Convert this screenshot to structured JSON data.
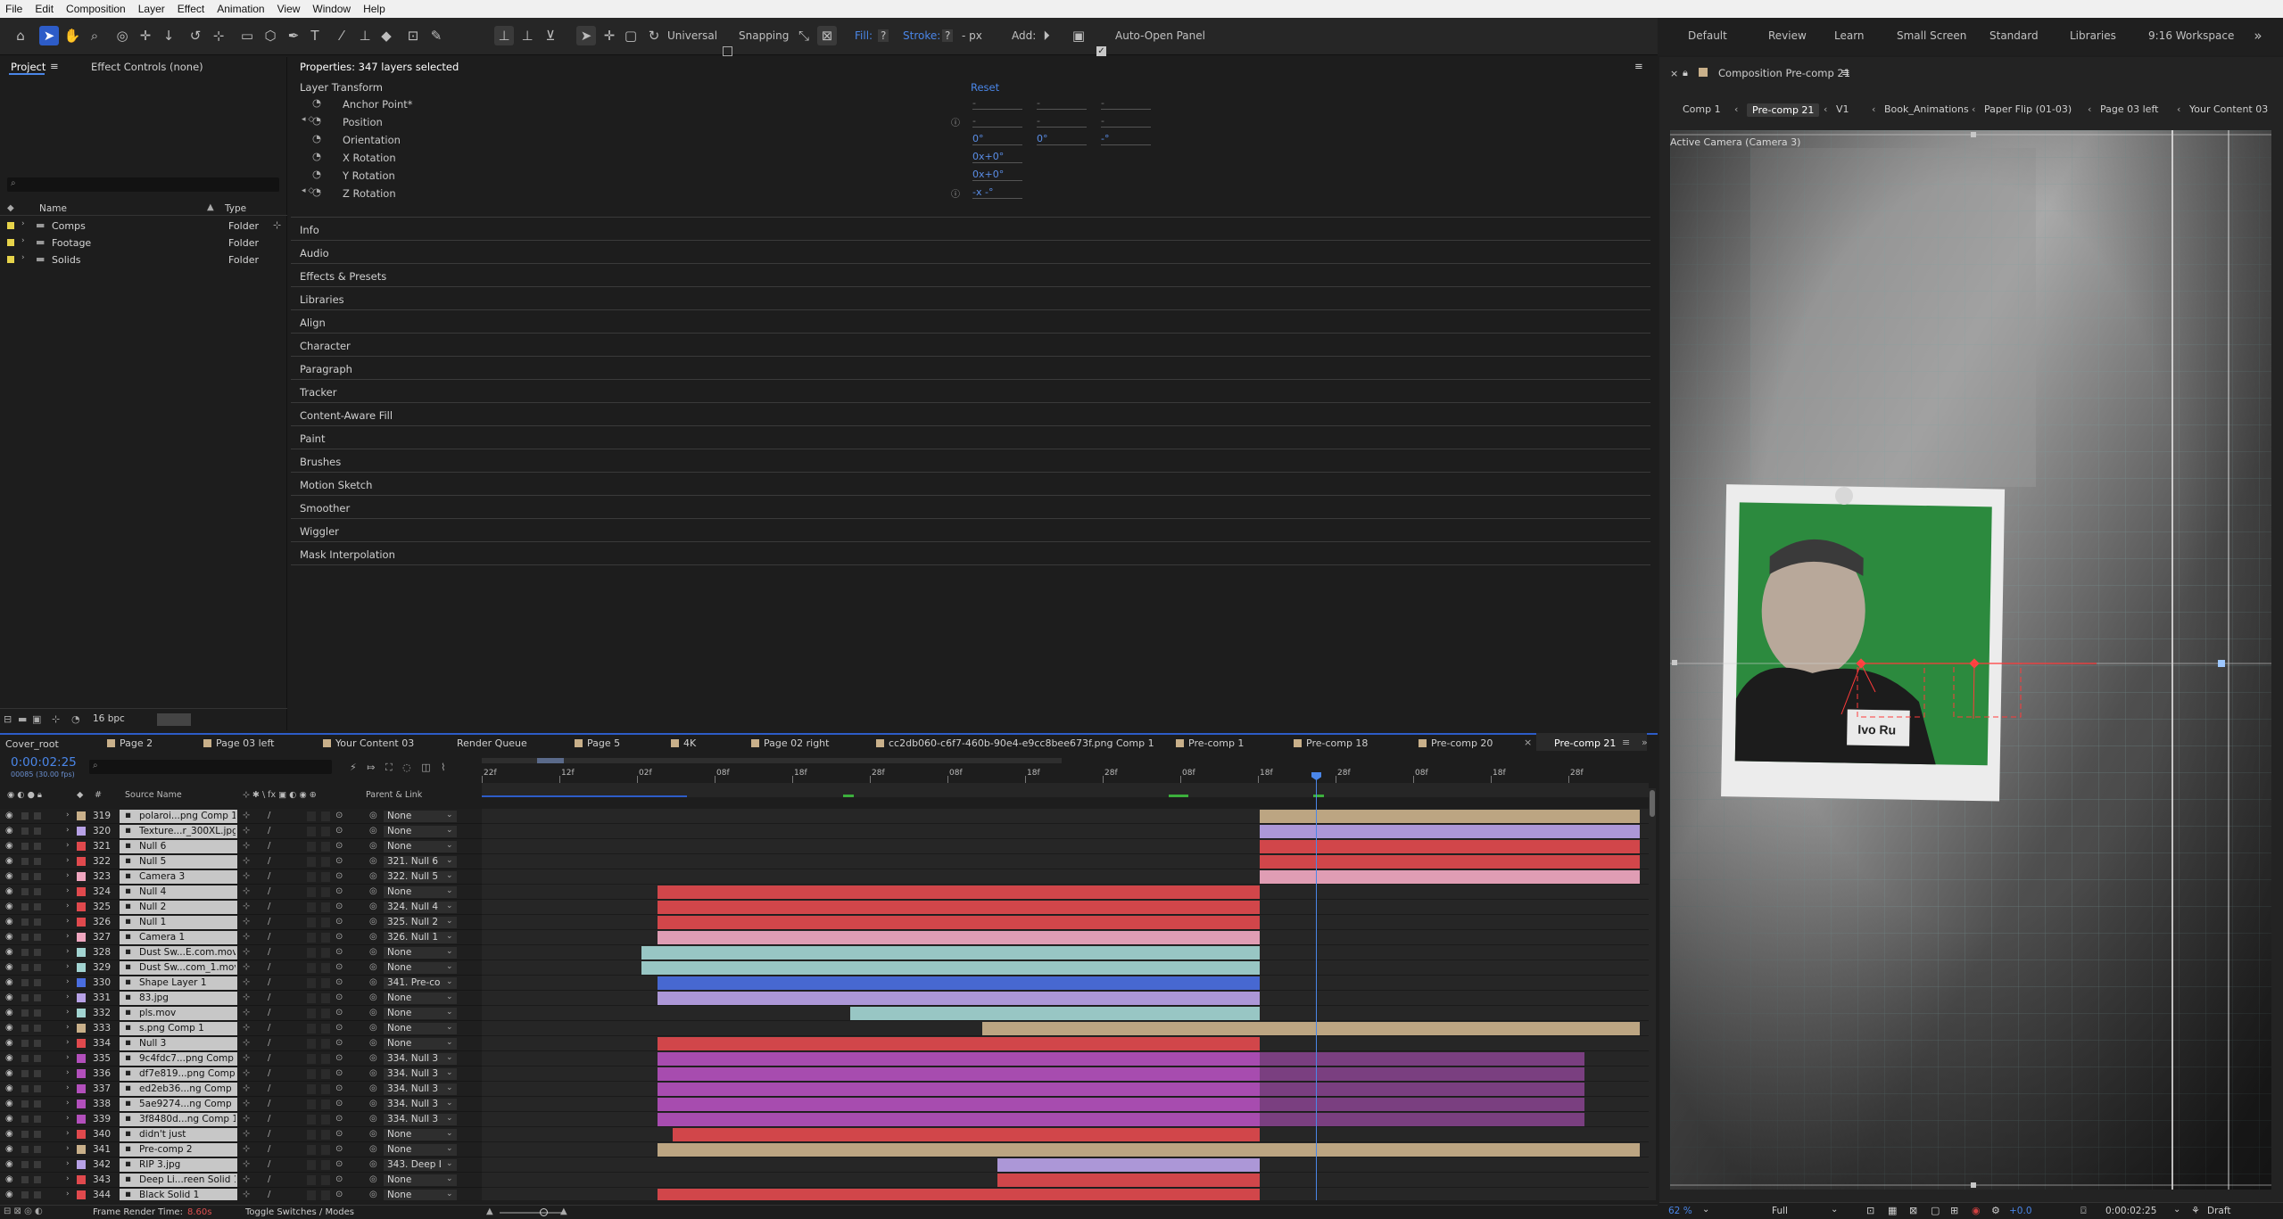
{
  "menu": [
    "File",
    "Edit",
    "Composition",
    "Layer",
    "Effect",
    "Animation",
    "View",
    "Window",
    "Help"
  ],
  "toolbar": {
    "universal": "Universal",
    "snapping": "Snapping",
    "fill": "Fill:",
    "stroke": "Stroke:",
    "stroke_px": "- px",
    "add": "Add:",
    "auto_open": "Auto-Open Panel",
    "fill_q": "?",
    "stroke_q": "?"
  },
  "workspaces": [
    "Default",
    "Review",
    "Learn",
    "Small Screen",
    "Standard",
    "Libraries",
    "9:16 Workspace"
  ],
  "project_panel": {
    "tab_project": "Project",
    "tab_effect": "Effect Controls (none)",
    "search_placeholder": "",
    "col_name": "Name",
    "col_type": "Type",
    "items": [
      {
        "name": "Comps",
        "type": "Folder"
      },
      {
        "name": "Footage",
        "type": "Folder"
      },
      {
        "name": "Solids",
        "type": "Folder"
      }
    ],
    "bpc": "16 bpc"
  },
  "properties": {
    "title": "Properties: 347 layers selected",
    "section": "Layer Transform",
    "reset": "Reset",
    "rows": [
      {
        "label": "Anchor Point*",
        "v1": "-",
        "v2": "-",
        "v3": "-"
      },
      {
        "label": "Position",
        "v1": "-",
        "v2": "-",
        "v3": "-"
      },
      {
        "label": "Orientation",
        "v1": "0°",
        "v2": "0°",
        "v3": "-°"
      },
      {
        "label": "X Rotation",
        "v1": "0x+0°",
        "v2": "",
        "v3": ""
      },
      {
        "label": "Y Rotation",
        "v1": "0x+0°",
        "v2": "",
        "v3": ""
      },
      {
        "label": "Z Rotation",
        "v1": "-x -°",
        "v2": "",
        "v3": ""
      }
    ],
    "panels": [
      "Info",
      "Audio",
      "Effects & Presets",
      "Libraries",
      "Align",
      "Character",
      "Paragraph",
      "Tracker",
      "Content-Aware Fill",
      "Paint",
      "Brushes",
      "Motion Sketch",
      "Smoother",
      "Wiggler",
      "Mask Interpolation"
    ]
  },
  "viewer": {
    "title": "Composition Pre-comp 21",
    "crumbs": [
      "Comp 1",
      "Pre-comp 21",
      "V1",
      "Book_Animations",
      "Paper Flip (01-03)",
      "Page 03 left",
      "Your Content 03"
    ],
    "camera": "Active Camera (Camera 3)",
    "zoom": "62 %",
    "resolution": "Full",
    "exposure": "+0.0",
    "timecode": "0:00:02:25",
    "draft": "Draft",
    "sign_text": "Ivo Ru"
  },
  "timeline": {
    "root_tab": "Cover_root",
    "tabs": [
      "Page 2",
      "Page 03 left",
      "Your Content 03",
      "Render Queue",
      "Page 5",
      "4K",
      "Page 02 right",
      "cc2db060-c6f7-460b-90e4-e9cc8bee673f.png Comp 1",
      "Pre-comp 1",
      "Pre-comp 18",
      "Pre-comp 20",
      "Pre-comp 21"
    ],
    "timecode": "0:00:02:25",
    "fps": "00085 (30.00 fps)",
    "col_hash": "#",
    "col_source": "Source Name",
    "col_parent": "Parent & Link",
    "ruler": [
      "22f",
      "12f",
      "02f",
      "08f",
      "18f",
      "28f",
      "08f",
      "18f",
      "28f",
      "08f",
      "18f",
      "28f",
      "08f",
      "18f",
      "28f"
    ],
    "footer_label": "Frame Render Time:",
    "footer_value": "8.60s",
    "footer_toggle": "Toggle Switches / Modes",
    "layers": [
      {
        "num": "319",
        "name": "polaroi...png Comp 1",
        "parent": "None",
        "color": "#c9b08a",
        "start": 0.672,
        "end": 1.0
      },
      {
        "num": "320",
        "name": "Texture...r_300XL.jpg",
        "parent": "None",
        "color": "#b7a1e6",
        "start": 0.672,
        "end": 1.0
      },
      {
        "num": "321",
        "name": "Null 6",
        "parent": "None",
        "color": "#e0494d",
        "start": 0.672,
        "end": 1.0
      },
      {
        "num": "322",
        "name": "Null 5",
        "parent": "321. Null 6",
        "color": "#e0494d",
        "start": 0.672,
        "end": 1.0
      },
      {
        "num": "323",
        "name": "Camera 3",
        "parent": "322. Null 5",
        "color": "#f0a7c0",
        "start": 0.672,
        "end": 1.0
      },
      {
        "num": "324",
        "name": "Null 4",
        "parent": "None",
        "color": "#e0494d",
        "start": 0.152,
        "end": 0.672
      },
      {
        "num": "325",
        "name": "Null 2",
        "parent": "324. Null 4",
        "color": "#e0494d",
        "start": 0.152,
        "end": 0.672
      },
      {
        "num": "326",
        "name": "Null 1",
        "parent": "325. Null 2",
        "color": "#e0494d",
        "start": 0.152,
        "end": 0.672
      },
      {
        "num": "327",
        "name": "Camera 1",
        "parent": "326. Null 1",
        "color": "#f0a7c0",
        "start": 0.152,
        "end": 0.672
      },
      {
        "num": "328",
        "name": "Dust Sw...E.com.mov",
        "parent": "None",
        "color": "#a2d4d1",
        "start": 0.138,
        "end": 0.672
      },
      {
        "num": "329",
        "name": "Dust Sw...com_1.mov",
        "parent": "None",
        "color": "#a2d4d1",
        "start": 0.138,
        "end": 0.672
      },
      {
        "num": "330",
        "name": "Shape Layer 1",
        "parent": "341. Pre-cor",
        "color": "#4a6ee0",
        "start": 0.152,
        "end": 0.672
      },
      {
        "num": "331",
        "name": "83.jpg",
        "parent": "None",
        "color": "#b7a1e6",
        "start": 0.152,
        "end": 0.672
      },
      {
        "num": "332",
        "name": "pls.mov",
        "parent": "None",
        "color": "#a2d4d1",
        "start": 0.318,
        "end": 0.672
      },
      {
        "num": "333",
        "name": "s.png Comp 1",
        "parent": "None",
        "color": "#c9b08a",
        "start": 0.432,
        "end": 1.0
      },
      {
        "num": "334",
        "name": "Null 3",
        "parent": "None",
        "color": "#e0494d",
        "start": 0.152,
        "end": 0.672
      },
      {
        "num": "335",
        "name": "9c4fdc7...png Comp 1",
        "parent": "334. Null 3",
        "color": "#b24fbb",
        "start": 0.152,
        "end": 0.952
      },
      {
        "num": "336",
        "name": "df7e819...png Comp 1",
        "parent": "334. Null 3",
        "color": "#b24fbb",
        "start": 0.152,
        "end": 0.952
      },
      {
        "num": "337",
        "name": "ed2eb36...ng Comp 1",
        "parent": "334. Null 3",
        "color": "#b24fbb",
        "start": 0.152,
        "end": 0.952
      },
      {
        "num": "338",
        "name": "5ae9274...ng Comp 1",
        "parent": "334. Null 3",
        "color": "#b24fbb",
        "start": 0.152,
        "end": 0.952
      },
      {
        "num": "339",
        "name": "3f8480d...ng Comp 1",
        "parent": "334. Null 3",
        "color": "#b24fbb",
        "start": 0.152,
        "end": 0.952
      },
      {
        "num": "340",
        "name": "didn't just",
        "parent": "None",
        "color": "#e0494d",
        "start": 0.165,
        "end": 0.672
      },
      {
        "num": "341",
        "name": "Pre-comp 2",
        "parent": "None",
        "color": "#c9b08a",
        "start": 0.152,
        "end": 1.0
      },
      {
        "num": "342",
        "name": "RIP 3.jpg",
        "parent": "343. Deep L",
        "color": "#b7a1e6",
        "start": 0.445,
        "end": 0.672
      },
      {
        "num": "343",
        "name": "Deep Li...reen Solid 1",
        "parent": "None",
        "color": "#e0494d",
        "start": 0.445,
        "end": 0.672
      },
      {
        "num": "344",
        "name": "Black Solid 1",
        "parent": "None",
        "color": "#e0494d",
        "start": 0.152,
        "end": 0.672
      }
    ]
  }
}
